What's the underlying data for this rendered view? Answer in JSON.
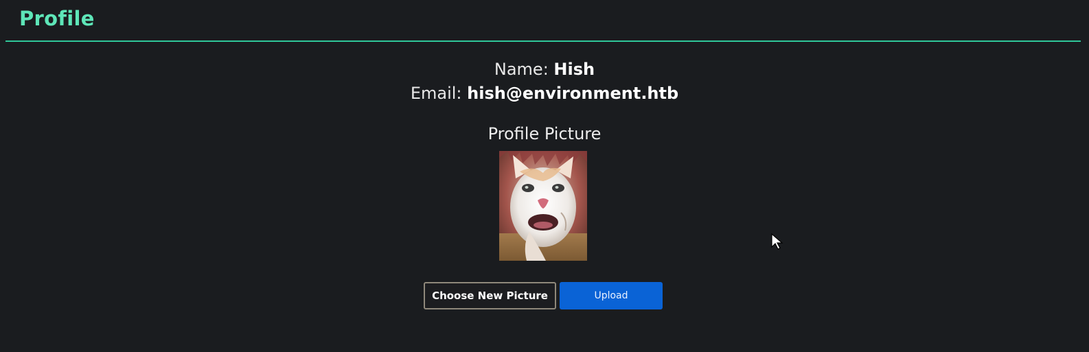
{
  "header": {
    "title": "Profile"
  },
  "profile": {
    "name_label": "Name:",
    "name_value": "Hish",
    "email_label": "Email:",
    "email_value": "hish@environment.htb",
    "picture_heading": "Profile Picture"
  },
  "actions": {
    "choose_label": "Choose New Picture",
    "upload_label": "Upload"
  },
  "colors": {
    "background": "#1a1c1f",
    "accent": "#5ee6b8",
    "divider": "#2fc79a",
    "upload_button": "#0a63d6"
  }
}
